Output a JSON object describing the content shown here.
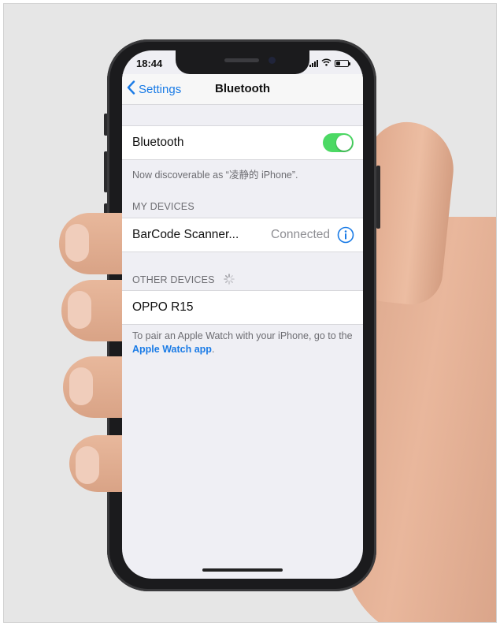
{
  "status_bar": {
    "time": "18:44"
  },
  "nav": {
    "back_label": "Settings",
    "title": "Bluetooth"
  },
  "bluetooth_row": {
    "label": "Bluetooth",
    "toggle_on": true
  },
  "discoverable_note": "Now discoverable as “凌静的 iPhone”.",
  "my_devices": {
    "header": "MY DEVICES",
    "items": [
      {
        "name": "BarCode Scanner...",
        "status": "Connected"
      }
    ]
  },
  "other_devices": {
    "header": "OTHER DEVICES",
    "items": [
      {
        "name": "OPPO R15"
      }
    ]
  },
  "pair_note": {
    "text": "To pair an Apple Watch with your iPhone, go to the ",
    "link": "Apple Watch app",
    "suffix": "."
  },
  "colors": {
    "accent": "#1a7be6",
    "toggle_on": "#4cd964",
    "background": "#efeff4",
    "secondary_text": "#8e8e93"
  },
  "icons": [
    "chevron-left-icon",
    "info-icon",
    "spinner-icon",
    "signal-icon",
    "wifi-icon",
    "battery-icon"
  ]
}
